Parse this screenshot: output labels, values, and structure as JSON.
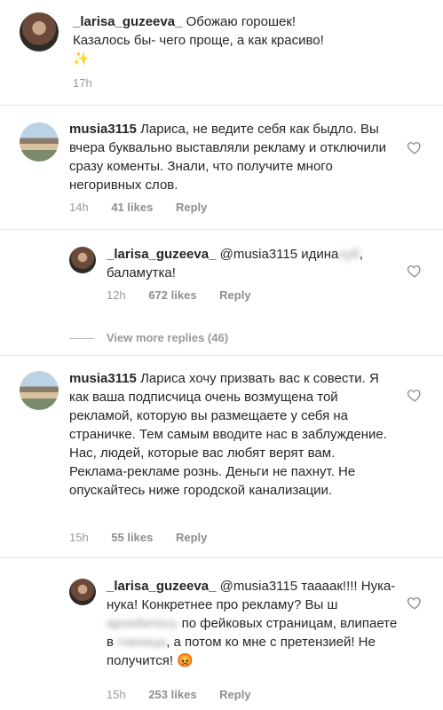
{
  "post_caption": {
    "username": "_larisa_guzeeva_",
    "text_line1": "Обожаю горошек!",
    "text_line2": "Казалось бы- чего проще, а как красиво!",
    "sparkle": "✨",
    "time": "17h"
  },
  "comments": [
    {
      "username": "musia3115",
      "text": "Лариса, не ведите себя как быдло. Вы вчера буквально выставляли рекламу и отключили сразу коменты. Знали, что получите много негоривных слов.",
      "time": "14h",
      "likes": "41 likes",
      "reply": "Reply"
    },
    {
      "username": "_larisa_guzeeva_",
      "mention": "@musia3115",
      "text_before_blur": "идина",
      "blurred": "хуй",
      "text_after": ", баламутка!",
      "time": "12h",
      "likes": "672 likes",
      "reply": "Reply"
    },
    {
      "view_more": "View more replies (46)"
    },
    {
      "username": "musia3115",
      "text": "Лариса хочу призвать вас к совести. Я как ваша подписчица очень возмущена той рекламой, которую вы размещаете у себя на страничке. Тем самым вводите нас в заблуждение. Нас, людей, которые вас любят верят вам. Реклама-рекламе рознь. Деньги не пахнут. Не опускайтесь ниже городской канализации.",
      "time": "15h",
      "likes": "55 likes",
      "reply": "Reply"
    },
    {
      "username": "_larisa_guzeeva_",
      "mention": "@musia3115",
      "part1": "таааак!!!! Нука- нука! Конкретнее про рекламу? Вы ш",
      "blur1": "арое6итесь",
      "part2": " по фейковых страницам, влипаете в ",
      "blur2": "говница",
      "part3": ", а потом ко мне с претензией! Не получится!",
      "emoji": "😡",
      "time": "15h",
      "likes": "253 likes",
      "reply": "Reply"
    }
  ],
  "colors": {
    "text": "#262626",
    "meta": "#9a9a9a",
    "background": "#ffffff"
  }
}
